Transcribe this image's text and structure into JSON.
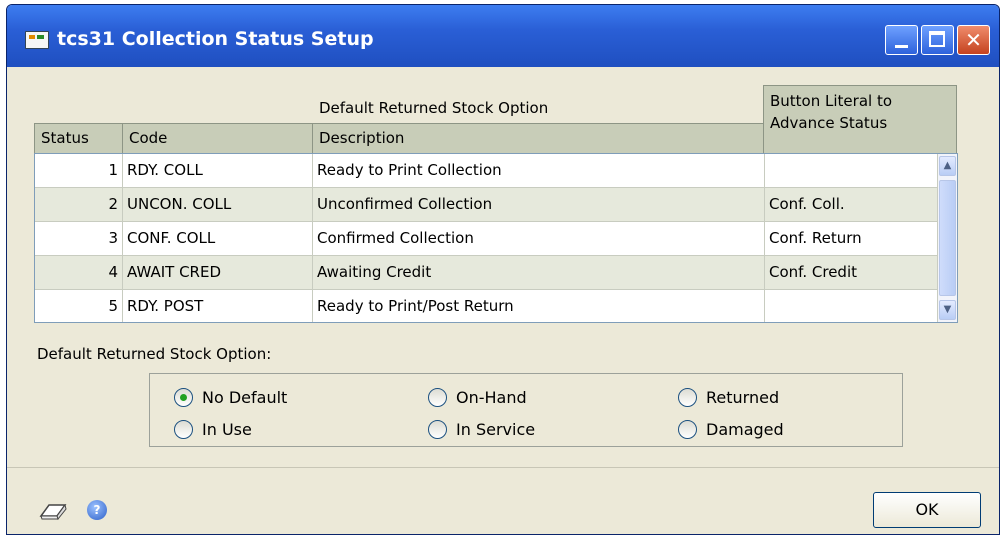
{
  "window": {
    "title": "tcs31 Collection Status Setup",
    "icon": "app-icon",
    "controls": {
      "minimize": "minimize-icon",
      "maximize": "maximize-icon",
      "close_glyph": "✕"
    }
  },
  "grid": {
    "group_header": "Default Returned Stock Option",
    "columns": [
      "Status",
      "Code",
      "Description",
      "Button Literal to Advance Status"
    ],
    "rows": [
      {
        "status": "1",
        "code": "RDY. COLL",
        "description": "Ready to Print Collection",
        "button_literal": ""
      },
      {
        "status": "2",
        "code": "UNCON. COLL",
        "description": "Unconfirmed Collection",
        "button_literal": "Conf. Coll."
      },
      {
        "status": "3",
        "code": "CONF. COLL",
        "description": "Confirmed Collection",
        "button_literal": "Conf. Return"
      },
      {
        "status": "4",
        "code": "AWAIT CRED",
        "description": "Awaiting Credit",
        "button_literal": "Conf. Credit"
      },
      {
        "status": "5",
        "code": "RDY. POST",
        "description": "Ready to Print/Post Return",
        "button_literal": ""
      }
    ],
    "scroll_up": "▲",
    "scroll_down": "▼"
  },
  "default_option": {
    "label": "Default Returned Stock Option:",
    "options": [
      {
        "label": "No Default",
        "selected": true
      },
      {
        "label": "On-Hand",
        "selected": false
      },
      {
        "label": "Returned",
        "selected": false
      },
      {
        "label": "In Use",
        "selected": false
      },
      {
        "label": "In Service",
        "selected": false
      },
      {
        "label": "Damaged",
        "selected": false
      }
    ]
  },
  "footer": {
    "ok_label": "OK",
    "note_icon": "note-icon",
    "help_icon": "help-icon",
    "help_glyph": "?"
  },
  "colors": {
    "titlebar": "#2a5fd6",
    "window_bg": "#ece9d8",
    "row_alt": "#e6e9dc",
    "header_bg": "#c8cdb8",
    "radio_selected": "#21a121"
  }
}
